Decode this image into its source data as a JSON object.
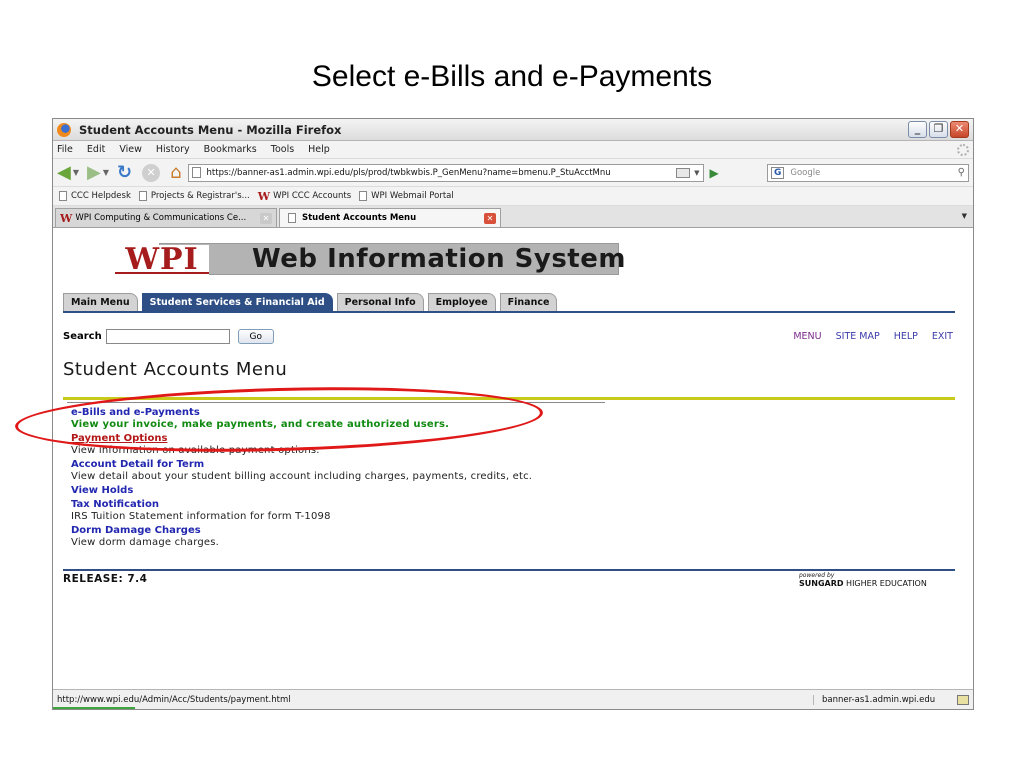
{
  "slide": {
    "title": "Select e-Bills and e-Payments"
  },
  "window": {
    "title": "Student Accounts Menu - Mozilla Firefox",
    "controls": {
      "minimize": "_",
      "restore": "❐",
      "close": "✕"
    }
  },
  "menubar": [
    "File",
    "Edit",
    "View",
    "History",
    "Bookmarks",
    "Tools",
    "Help"
  ],
  "toolbar": {
    "url": "https://banner-as1.admin.wpi.edu/pls/prod/twbkwbis.P_GenMenu?name=bmenu.P_StuAcctMnu",
    "search_engine": "G",
    "search_placeholder": "Google"
  },
  "bookmarks": [
    "CCC Helpdesk",
    "Projects & Registrar's...",
    "WPI CCC Accounts",
    "WPI Webmail Portal"
  ],
  "tabs": [
    {
      "label": "WPI Computing & Communications Ce...",
      "active": false
    },
    {
      "label": "Student Accounts Menu",
      "active": true
    }
  ],
  "page": {
    "logo": "WPI",
    "banner": "Web Information System",
    "nav_tabs": [
      "Main Menu",
      "Student Services & Financial Aid",
      "Personal Info",
      "Employee",
      "Finance"
    ],
    "search_label": "Search",
    "go_label": "Go",
    "top_links": [
      "MENU",
      "SITE MAP",
      "HELP",
      "EXIT"
    ],
    "title": "Student Accounts Menu",
    "menu_items": [
      {
        "link": "e-Bills and e-Payments",
        "desc": "View your invoice, make payments, and create authorized users."
      },
      {
        "link": "Payment Options",
        "desc": "View information on available payment options."
      },
      {
        "link": "Account Detail for Term",
        "desc": "View detail about your student billing account including charges, payments, credits, etc."
      },
      {
        "link": "View Holds",
        "desc": ""
      },
      {
        "link": "Tax Notification",
        "desc": "IRS Tuition Statement information for form T-1098"
      },
      {
        "link": "Dorm Damage Charges",
        "desc": "View dorm damage charges."
      }
    ],
    "release": "RELEASE: 7.4",
    "powered_by": "powered by",
    "sungard_brand": "SUNGARD",
    "sungard_rest": " HIGHER EDUCATION"
  },
  "statusbar": {
    "url": "http://www.wpi.edu/Admin/Acc/Students/payment.html",
    "host": "banner-as1.admin.wpi.edu"
  },
  "colors": {
    "wpi_red": "#a61c1c",
    "nav_blue": "#2e4f85",
    "gold": "#c9c91a",
    "annotation": "#e01818"
  }
}
